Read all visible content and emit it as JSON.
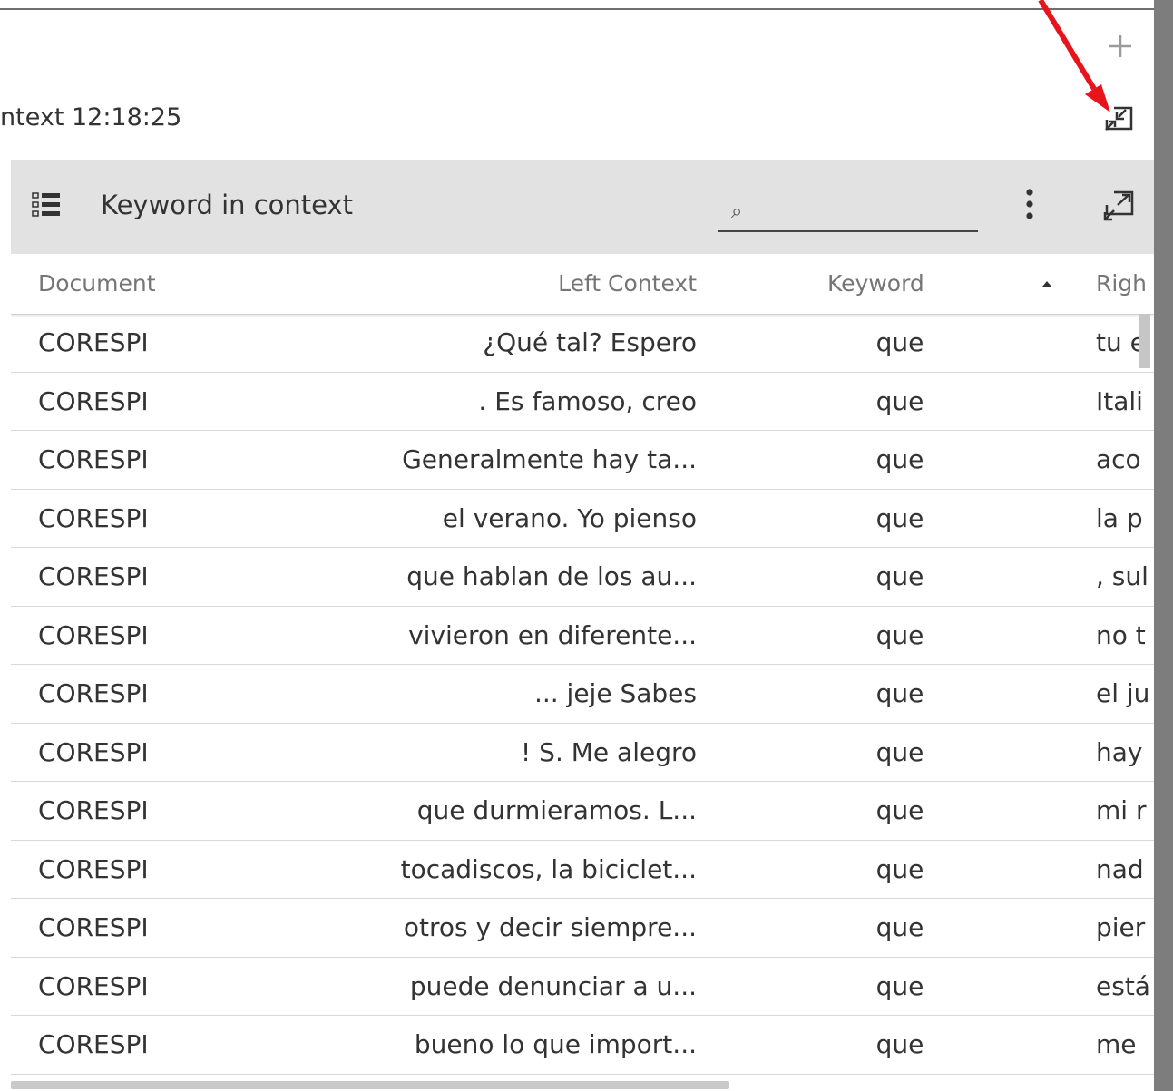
{
  "tab": {
    "title": "ntext 12:18:25",
    "add_icon": "plus-icon",
    "restore_icon": "minimize-window-icon"
  },
  "panel": {
    "title": "Keyword in context",
    "list_icon": "list-icon",
    "search": {
      "icon": "⌕",
      "placeholder": "",
      "value": ""
    },
    "menu_icon": "more-vertical-icon",
    "expand_icon": "expand-window-icon"
  },
  "table": {
    "columns": [
      "Document",
      "Left Context",
      "Keyword",
      "Righ"
    ],
    "sorted_column": "Keyword",
    "rows": [
      {
        "document": "CORESPI",
        "left": "¿Qué tal? Espero",
        "keyword": "que",
        "right": "tu e"
      },
      {
        "document": "CORESPI",
        "left": ". Es famoso, creo",
        "keyword": "que",
        "right": "Itali"
      },
      {
        "document": "CORESPI",
        "left": "Generalmente hay ta...",
        "keyword": "que",
        "right": "aco"
      },
      {
        "document": "CORESPI",
        "left": "el verano. Yo pienso",
        "keyword": "que",
        "right": "la p"
      },
      {
        "document": "CORESPI",
        "left": "que hablan de los au...",
        "keyword": "que",
        "right": ", sul"
      },
      {
        "document": "CORESPI",
        "left": "vivieron en diferente...",
        "keyword": "que",
        "right": "no t"
      },
      {
        "document": "CORESPI",
        "left": "... jeje Sabes",
        "keyword": "que",
        "right": "el ju"
      },
      {
        "document": "CORESPI",
        "left": "! S. Me alegro",
        "keyword": "que",
        "right": "hay"
      },
      {
        "document": "CORESPI",
        "left": "que durmieramos. L...",
        "keyword": "que",
        "right": "mi r"
      },
      {
        "document": "CORESPI",
        "left": "tocadiscos, la biciclet...",
        "keyword": "que",
        "right": "nad"
      },
      {
        "document": "CORESPI",
        "left": "otros y decir siempre...",
        "keyword": "que",
        "right": "pier"
      },
      {
        "document": "CORESPI",
        "left": "puede denunciar a u...",
        "keyword": "que",
        "right": "está"
      },
      {
        "document": "CORESPI",
        "left": "bueno lo que import...",
        "keyword": "que",
        "right": "me"
      }
    ]
  },
  "colors": {
    "header_bg": "#e2e2e2",
    "arrow": "#e8141c",
    "scrollbar": "#7d7d7d"
  }
}
